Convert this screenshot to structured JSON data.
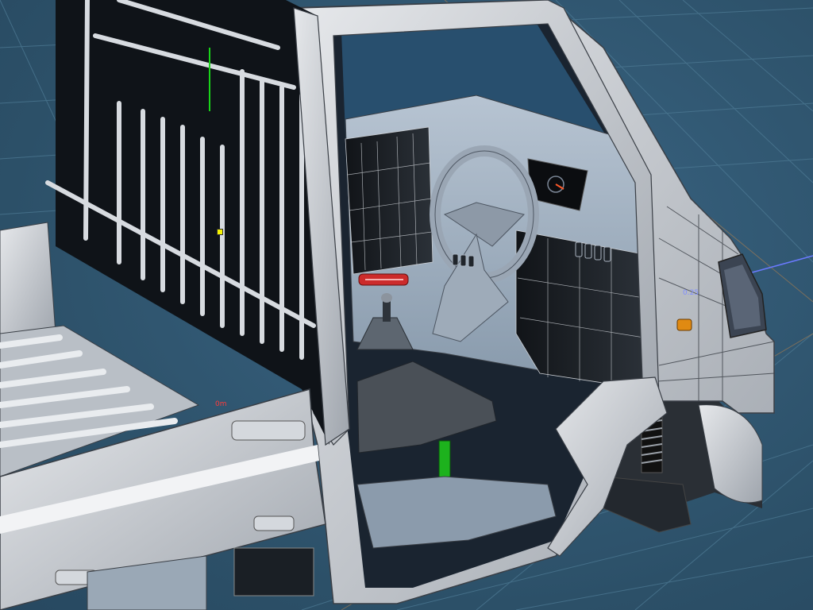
{
  "viewport": {
    "background_color": "#2f5571",
    "grid_color": "#4f7c96",
    "grid_highlight_color": "#b9834a",
    "model_fill_color": "#c9cdd2",
    "model_shadow_color": "#1b1f24",
    "wire_color": "#3a3f46",
    "interior_color": "#a7b6c6",
    "axis_x_color": "#6a7aff",
    "axis_y_color": "#19d419",
    "axis_z_color": "#ff3b3b"
  },
  "labels": {
    "origin": "0m",
    "scale": "0.25"
  },
  "icons": {
    "pivot": "pivot-marker-icon",
    "axis_y": "y-axis-icon",
    "axis_x": "x-axis-icon"
  }
}
